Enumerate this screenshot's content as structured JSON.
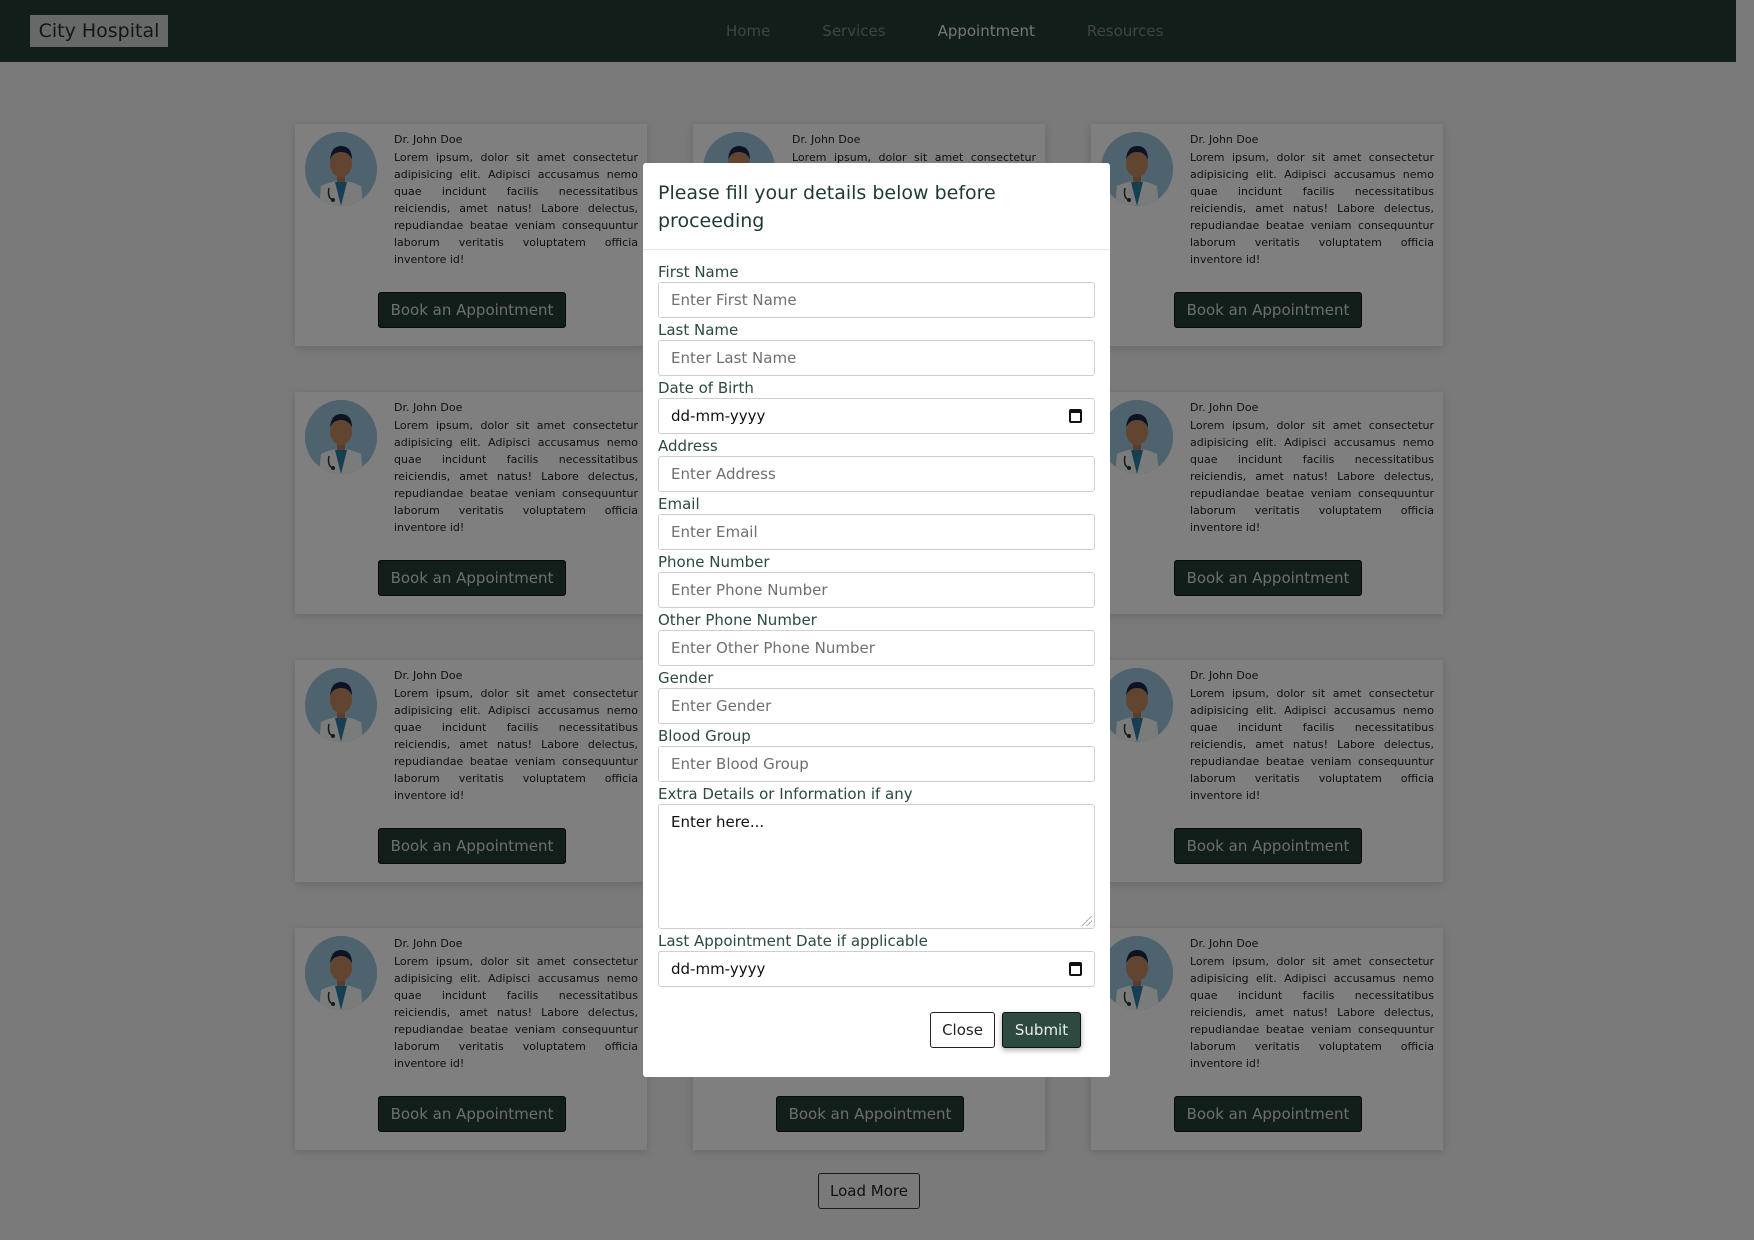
{
  "navbar": {
    "brand": "City Hospital",
    "links": [
      "Home",
      "Services",
      "Appointment",
      "Resources"
    ],
    "active_link": "Appointment"
  },
  "doctor_card": {
    "name": "Dr. John Doe",
    "description": "Lorem ipsum, dolor sit amet consectetur adipisicing elit. Adipisci accusamus nemo quae incidunt facilis necessitatibus reiciendis, amet natus! Labore delectus, repudiandae beatae veniam consequuntur laborum veritatis voluptatem officia inventore id!",
    "button_label": "Book an Appointment"
  },
  "cards_count": 12,
  "load_more_label": "Load More",
  "modal": {
    "title": "Please fill your details below before proceeding",
    "fields": [
      {
        "label": "First Name",
        "placeholder": "Enter First Name"
      },
      {
        "label": "Last Name",
        "placeholder": "Enter Last Name"
      },
      {
        "label": "Date of Birth",
        "placeholder": "dd-mm-yyyy"
      },
      {
        "label": "Address",
        "placeholder": "Enter Address"
      },
      {
        "label": "Email",
        "placeholder": "Enter Email"
      },
      {
        "label": "Phone Number",
        "placeholder": "Enter Phone Number"
      },
      {
        "label": "Other Phone Number",
        "placeholder": "Enter Other Phone Number"
      },
      {
        "label": "Gender",
        "placeholder": "Enter Gender"
      },
      {
        "label": "Blood Group",
        "placeholder": "Enter Blood Group"
      },
      {
        "label": "Extra Details or Information if any",
        "placeholder": "Enter here..."
      },
      {
        "label": "Last Appointment Date if applicable",
        "placeholder": "dd-mm-yyyy"
      }
    ],
    "close_label": "Close",
    "submit_label": "Submit"
  },
  "colors": {
    "primary": "#243d35",
    "overlay": "rgba(0,0,0,0.5)"
  },
  "icons": {
    "avatar": "doctor-avatar-icon",
    "calendar": "calendar-icon",
    "resize": "resize-handle-icon"
  }
}
